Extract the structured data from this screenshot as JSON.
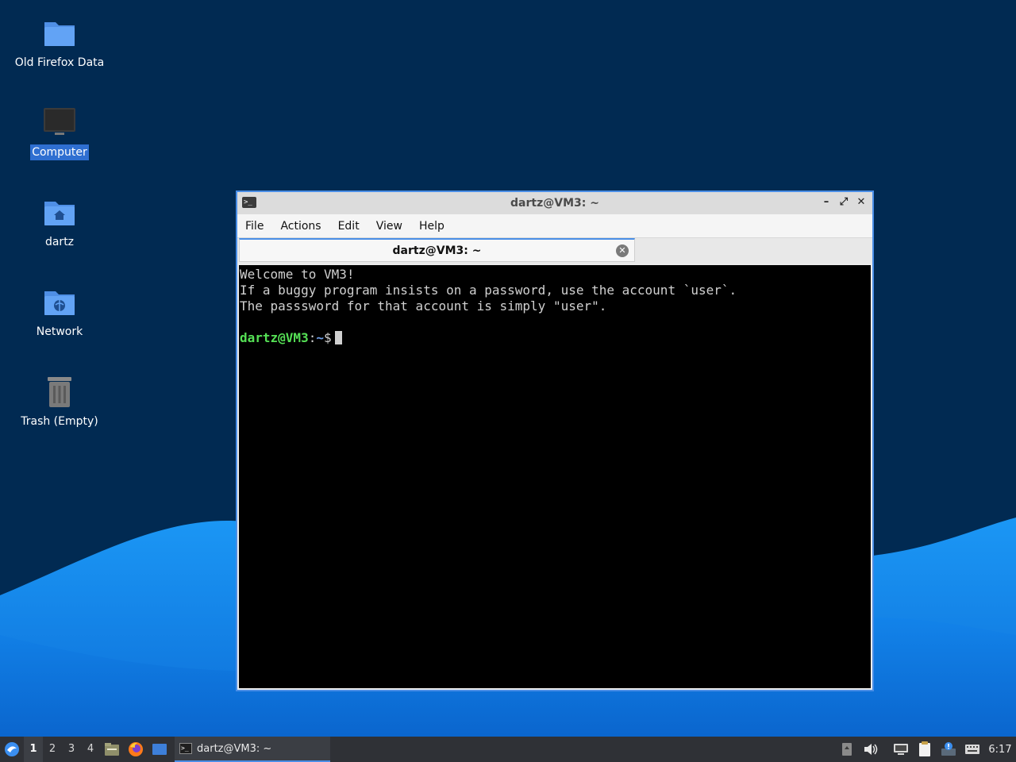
{
  "desktop": {
    "icons": [
      {
        "label": "Old Firefox Data",
        "icon": "folder-icon"
      },
      {
        "label": "Computer",
        "icon": "computer-icon",
        "selected": true
      },
      {
        "label": "dartz",
        "icon": "home-folder-icon"
      },
      {
        "label": "Network",
        "icon": "network-folder-icon"
      },
      {
        "label": "Trash (Empty)",
        "icon": "trash-icon"
      }
    ]
  },
  "window": {
    "title": "dartz@VM3: ~",
    "controls": [
      "minimize",
      "maximize",
      "close"
    ],
    "menu": [
      "File",
      "Actions",
      "Edit",
      "View",
      "Help"
    ],
    "tab": {
      "label": "dartz@VM3: ~"
    },
    "terminal": {
      "lines": [
        "Welcome to VM3!",
        "If a buggy program insists on a password, use the account `user`.",
        "The passsword for that account is simply \"user\"."
      ],
      "prompt": {
        "user_host": "dartz@VM3",
        "sep": ":",
        "path": "~",
        "symbol": "$"
      }
    }
  },
  "taskbar": {
    "workspaces": [
      "1",
      "2",
      "3",
      "4"
    ],
    "active_workspace": "1",
    "quicklaunch": [
      "file-manager-icon",
      "firefox-icon",
      "show-desktop-icon"
    ],
    "task": {
      "label": "dartz@VM3: ~"
    },
    "tray": [
      "storage-icon",
      "volume-icon",
      "network-icon",
      "clipboard-icon",
      "update-icon",
      "keyboard-icon"
    ],
    "clock": "6:17"
  },
  "colors": {
    "wallpaper_dark": "#002a52",
    "wallpaper_wave": "#1a8cf0",
    "selection": "#2f6fd1",
    "accent": "#4a8ee6",
    "prompt_user": "#55e055",
    "prompt_path": "#6f9fe8"
  }
}
